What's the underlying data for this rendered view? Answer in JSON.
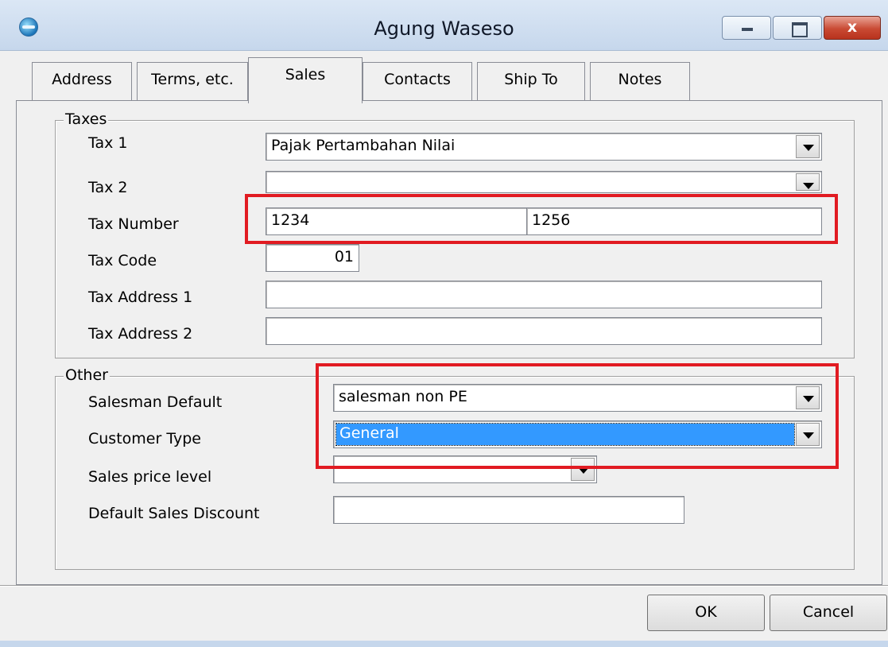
{
  "window": {
    "title": "Agung Waseso",
    "close_glyph": "x"
  },
  "tabs": [
    {
      "label": "Address",
      "active": false
    },
    {
      "label": "Terms, etc.",
      "active": false
    },
    {
      "label": "Sales",
      "active": true
    },
    {
      "label": "Contacts",
      "active": false
    },
    {
      "label": "Ship To",
      "active": false
    },
    {
      "label": "Notes",
      "active": false
    }
  ],
  "taxes": {
    "group_title": "Taxes",
    "tax1": {
      "label": "Tax 1",
      "value": "Pajak Pertambahan Nilai"
    },
    "tax2": {
      "label": "Tax 2",
      "value": ""
    },
    "tax_number": {
      "label": "Tax Number",
      "value_1": "1234",
      "value_2": "1256"
    },
    "tax_code": {
      "label": "Tax Code",
      "value": "01"
    },
    "tax_address_1": {
      "label": "Tax Address 1",
      "value": ""
    },
    "tax_address_2": {
      "label": "Tax Address 2",
      "value": ""
    }
  },
  "other": {
    "group_title": "Other",
    "salesman_default": {
      "label": "Salesman Default",
      "value": "salesman non PE"
    },
    "customer_type": {
      "label": "Customer Type",
      "value": "General"
    },
    "sales_price_level": {
      "label": "Sales price level",
      "value": ""
    },
    "default_sales_discount": {
      "label": "Default Sales Discount",
      "value": ""
    }
  },
  "buttons": {
    "ok": "OK",
    "cancel": "Cancel"
  },
  "colors": {
    "highlight": "#e11b22",
    "selection": "#3399ff"
  }
}
